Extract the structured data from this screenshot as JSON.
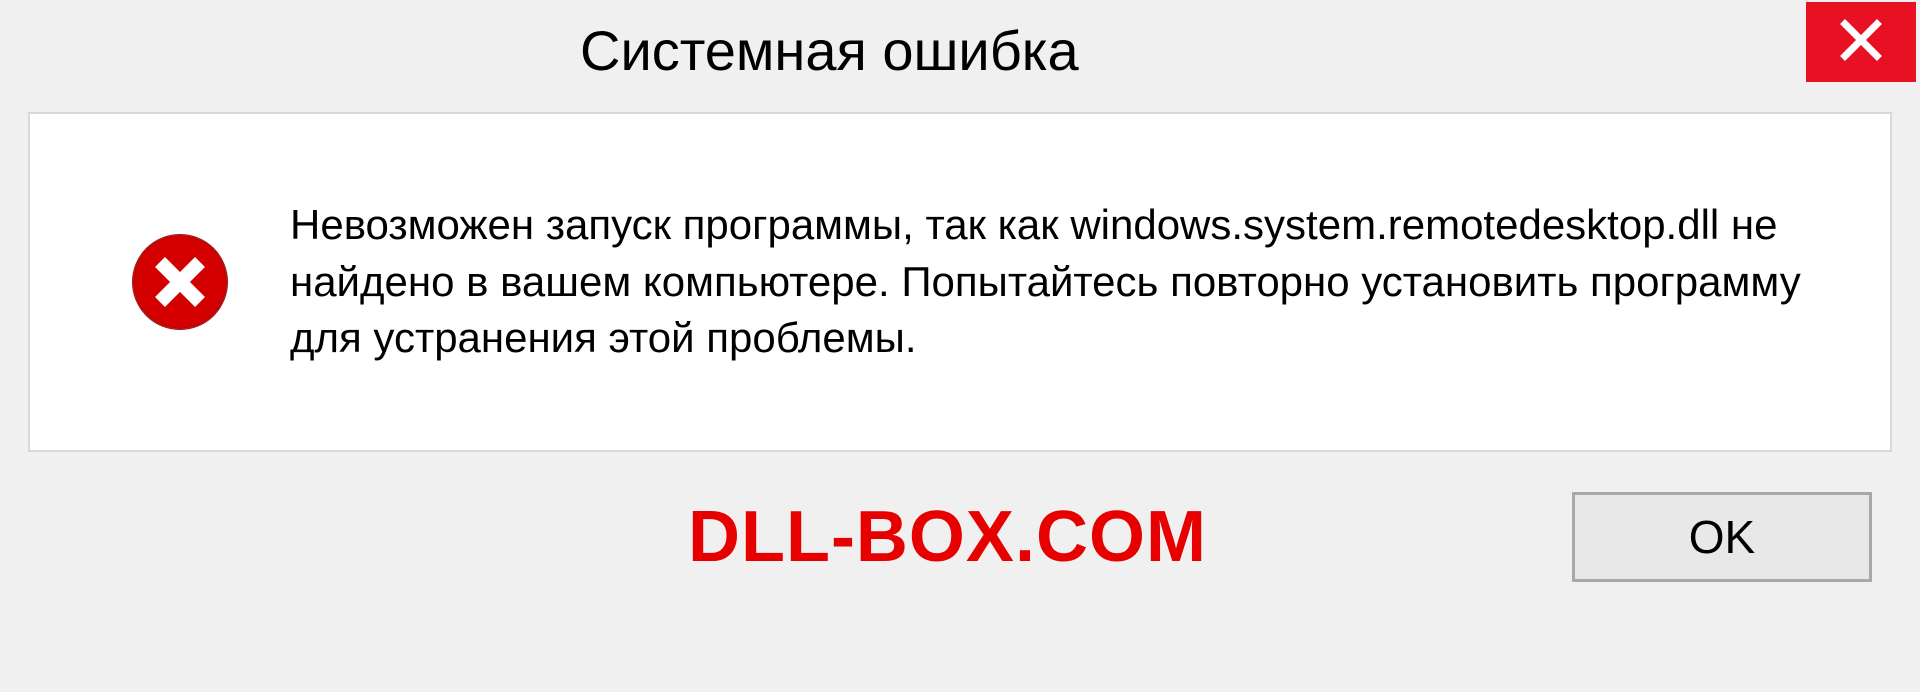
{
  "dialog": {
    "title": "Системная ошибка",
    "message": "Невозможен запуск программы, так как windows.system.remotedesktop.dll не найдено в вашем компьютере. Попытайтесь повторно установить программу для устранения этой проблемы.",
    "ok_label": "OK"
  },
  "watermark": "DLL-BOX.COM"
}
